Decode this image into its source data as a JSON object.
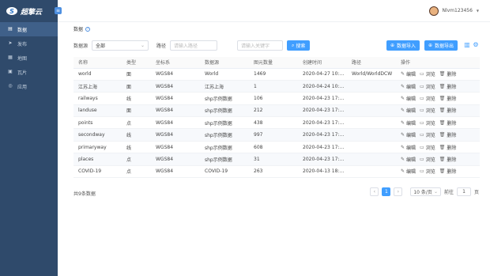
{
  "app": {
    "logo_mark": "S",
    "logo_text": "超擎云",
    "collapse_icon": "≡"
  },
  "sidebar": {
    "items": [
      {
        "label": "数据",
        "icon": "▤",
        "active": true
      },
      {
        "label": "发布",
        "icon": "➤"
      },
      {
        "label": "地图",
        "icon": "▦"
      },
      {
        "label": "瓦片",
        "icon": "▣"
      },
      {
        "label": "应用",
        "icon": "◎"
      }
    ]
  },
  "topbar": {
    "username": "Nlvm123456",
    "caret": "▼"
  },
  "breadcrumb": {
    "label": "数据",
    "help": "?"
  },
  "filters": {
    "source_label": "数据源",
    "source_value": "全部",
    "source_caret": "⌄",
    "path_label": "路径",
    "path_placeholder": "请输入路径",
    "name_placeholder": "请输入关键字",
    "search_label": "搜索",
    "search_icon": "⌕"
  },
  "actions": {
    "import_label": "数据导入",
    "import_icon": "⊕",
    "export_label": "数据导出",
    "export_icon": "⊕",
    "column_icon": "▥",
    "settings_icon": "⚙"
  },
  "table": {
    "headers": [
      "名称",
      "类型",
      "坐标系",
      "数据源",
      "图元数量",
      "创建时间",
      "路径",
      "操作"
    ],
    "rows": [
      {
        "name": "world",
        "type": "面",
        "crs": "WGS84",
        "source": "World",
        "count": "1469",
        "created": "2020-04-27 10:56...",
        "path": "World/WorldDCW"
      },
      {
        "name": "江苏上海",
        "type": "面",
        "crs": "WGS84",
        "source": "江苏上海",
        "count": "1",
        "created": "2020-04-24 10:24...",
        "path": ""
      },
      {
        "name": "railways",
        "type": "线",
        "crs": "WGS84",
        "source": "shp示例数据",
        "count": "106",
        "created": "2020-04-23 17:36...",
        "path": ""
      },
      {
        "name": "landuse",
        "type": "面",
        "crs": "WGS84",
        "source": "shp示例数据",
        "count": "212",
        "created": "2020-04-23 17:36...",
        "path": ""
      },
      {
        "name": "points",
        "type": "点",
        "crs": "WGS84",
        "source": "shp示例数据",
        "count": "438",
        "created": "2020-04-23 17:36...",
        "path": ""
      },
      {
        "name": "secondway",
        "type": "线",
        "crs": "WGS84",
        "source": "shp示例数据",
        "count": "997",
        "created": "2020-04-23 17:36...",
        "path": ""
      },
      {
        "name": "primaryway",
        "type": "线",
        "crs": "WGS84",
        "source": "shp示例数据",
        "count": "608",
        "created": "2020-04-23 17:36...",
        "path": ""
      },
      {
        "name": "places",
        "type": "点",
        "crs": "WGS84",
        "source": "shp示例数据",
        "count": "31",
        "created": "2020-04-23 17:36...",
        "path": ""
      },
      {
        "name": "COVID-19",
        "type": "点",
        "crs": "WGS84",
        "source": "COVID-19",
        "count": "263",
        "created": "2020-04-13 18:10...",
        "path": ""
      }
    ],
    "ops": [
      {
        "label": "编辑",
        "icon": "✎"
      },
      {
        "label": "浏览",
        "icon": "▭"
      },
      {
        "label": "删除",
        "icon": "🗑"
      }
    ]
  },
  "footer": {
    "total": "共9条数据",
    "prev": "‹",
    "page": "1",
    "next": "›",
    "page_size": "10 条/页",
    "page_size_caret": "⌄",
    "goto_label": "前往",
    "goto_value": "1",
    "goto_suffix": "页"
  }
}
